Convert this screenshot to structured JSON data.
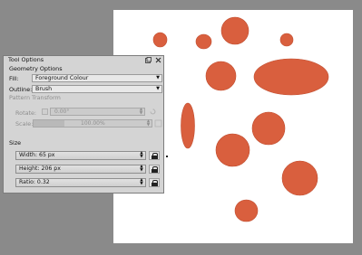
{
  "tool_options": {
    "title": "Tool Options",
    "geometry_options_label": "Geometry Options",
    "fill_label": "Fill:",
    "fill_value": "Foreground Colour",
    "outline_label": "Outline:",
    "outline_value": "Brush",
    "pattern_transform_label": "Pattern Transform",
    "rotate_label": "Rotate:",
    "rotate_value": "0.00°",
    "scale_label": "Scale:",
    "scale_value": "100.00%",
    "size_label": "Size",
    "width_value": "Width: 65 px",
    "height_value": "Height: 206 px",
    "ratio_value": "Ratio: 0.32"
  },
  "canvas": {
    "page_color": "#ffffff",
    "shape_color": "#d95f3e",
    "shape_outline": "#c04e30",
    "workspace_color": "#8a8a8a"
  }
}
